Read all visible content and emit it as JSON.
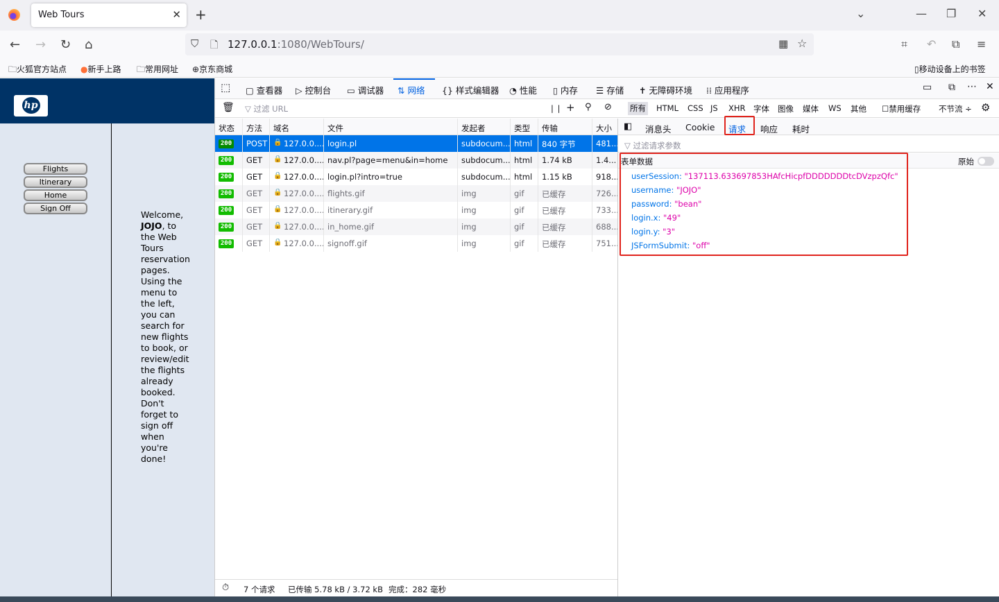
{
  "browser": {
    "tab_title": "Web Tours",
    "url_host": "127.0.0.1",
    "url_rest": ":1080/WebTours/",
    "bookmarks": [
      "火狐官方站点",
      "新手上路",
      "常用网址",
      "京东商城"
    ],
    "mobile_bookmarks": "移动设备上的书签"
  },
  "page": {
    "menu": [
      "Flights",
      "Itinerary",
      "Home",
      "Sign Off"
    ],
    "welcome_lines": [
      "Welcome,",
      "JOJO, to",
      "the Web",
      "Tours",
      "reservation",
      "pages.",
      "Using the",
      "menu to",
      "the left,",
      "you can",
      "search for",
      "new flights",
      "to book, or",
      "review/edit",
      "the flights",
      "already",
      "booked.",
      "Don't",
      "forget to",
      "sign off",
      "when",
      "you're",
      "done!"
    ]
  },
  "devtools": {
    "tabs": [
      "查看器",
      "控制台",
      "调试器",
      "网络",
      "样式编辑器",
      "性能",
      "内存",
      "存储",
      "无障碍环境",
      "应用程序"
    ],
    "filter_placeholder": "过滤 URL",
    "type_filters": [
      "所有",
      "HTML",
      "CSS",
      "JS",
      "XHR",
      "字体",
      "图像",
      "媒体",
      "WS",
      "其他"
    ],
    "disable_cache": "禁用缓存",
    "throttle": "不节流 ÷",
    "columns": [
      "状态",
      "方法",
      "域名",
      "文件",
      "发起者",
      "类型",
      "传输",
      "大小"
    ],
    "rows": [
      {
        "status": "200",
        "method": "POST",
        "domain": "127.0.0....",
        "file": "login.pl",
        "initiator": "subdocum...",
        "type": "html",
        "transfer": "840 字节",
        "size": "481..."
      },
      {
        "status": "200",
        "method": "GET",
        "domain": "127.0.0....",
        "file": "nav.pl?page=menu&in=home",
        "initiator": "subdocum...",
        "type": "html",
        "transfer": "1.74 kB",
        "size": "1.4..."
      },
      {
        "status": "200",
        "method": "GET",
        "domain": "127.0.0....",
        "file": "login.pl?intro=true",
        "initiator": "subdocum...",
        "type": "html",
        "transfer": "1.15 kB",
        "size": "918..."
      },
      {
        "status": "200",
        "method": "GET",
        "domain": "127.0.0....",
        "file": "flights.gif",
        "initiator": "img",
        "type": "gif",
        "transfer": "已缓存",
        "size": "726..."
      },
      {
        "status": "200",
        "method": "GET",
        "domain": "127.0.0....",
        "file": "itinerary.gif",
        "initiator": "img",
        "type": "gif",
        "transfer": "已缓存",
        "size": "733..."
      },
      {
        "status": "200",
        "method": "GET",
        "domain": "127.0.0....",
        "file": "in_home.gif",
        "initiator": "img",
        "type": "gif",
        "transfer": "已缓存",
        "size": "688..."
      },
      {
        "status": "200",
        "method": "GET",
        "domain": "127.0.0....",
        "file": "signoff.gif",
        "initiator": "img",
        "type": "gif",
        "transfer": "已缓存",
        "size": "751..."
      }
    ],
    "status_bar": {
      "requests": "7 个请求",
      "transferred": "已传输 5.78 kB / 3.72 kB",
      "finished": "完成：282 毫秒"
    },
    "detail_tabs": [
      "消息头",
      "Cookie",
      "请求",
      "响应",
      "耗时"
    ],
    "param_filter": "过滤请求参数",
    "form_title": "表单数据",
    "raw_label": "原始",
    "params": [
      {
        "key": "userSession:",
        "value": "\"137113.633697853HAfcHicpfDDDDDDDtcDVzpzQfc\""
      },
      {
        "key": "username:",
        "value": "\"JOJO\""
      },
      {
        "key": "password:",
        "value": "\"bean\""
      },
      {
        "key": "login.x:",
        "value": "\"49\""
      },
      {
        "key": "login.y:",
        "value": "\"3\""
      },
      {
        "key": "JSFormSubmit:",
        "value": "\"off\""
      }
    ]
  }
}
